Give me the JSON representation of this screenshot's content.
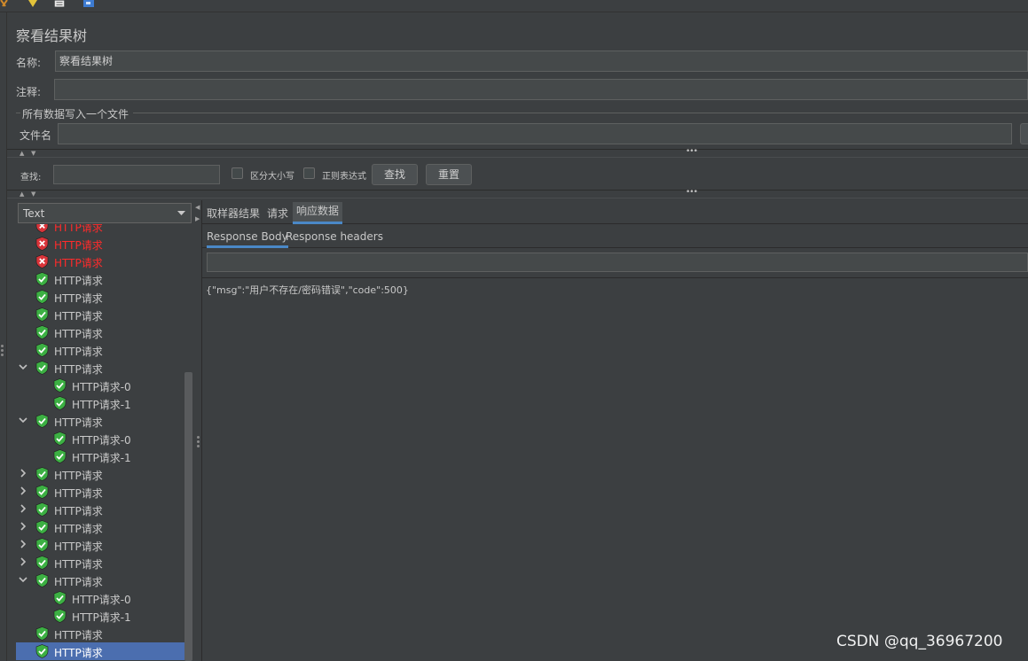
{
  "panel": {
    "title": "察看结果树",
    "name_label": "名称:",
    "name_value": "察看结果树",
    "comment_label": "注释:",
    "comment_value": "",
    "file_group_label": "所有数据写入一个文件",
    "filename_label": "文件名",
    "filename_value": ""
  },
  "search": {
    "label": "查找:",
    "value": "",
    "case_sensitive_label": "区分大小写",
    "regex_label": "正则表达式",
    "find_button": "查找",
    "reset_button": "重置"
  },
  "renderer_select": {
    "selected": "Text"
  },
  "tree": {
    "items": [
      {
        "label": "HTTP请求",
        "status": "error",
        "level": 0,
        "expander": "none"
      },
      {
        "label": "HTTP请求",
        "status": "error",
        "level": 0,
        "expander": "none"
      },
      {
        "label": "HTTP请求",
        "status": "error",
        "level": 0,
        "expander": "none"
      },
      {
        "label": "HTTP请求",
        "status": "ok",
        "level": 0,
        "expander": "none"
      },
      {
        "label": "HTTP请求",
        "status": "ok",
        "level": 0,
        "expander": "none"
      },
      {
        "label": "HTTP请求",
        "status": "ok",
        "level": 0,
        "expander": "none"
      },
      {
        "label": "HTTP请求",
        "status": "ok",
        "level": 0,
        "expander": "none"
      },
      {
        "label": "HTTP请求",
        "status": "ok",
        "level": 0,
        "expander": "none"
      },
      {
        "label": "HTTP请求",
        "status": "ok",
        "level": 0,
        "expander": "expanded"
      },
      {
        "label": "HTTP请求-0",
        "status": "ok",
        "level": 1,
        "expander": "none"
      },
      {
        "label": "HTTP请求-1",
        "status": "ok",
        "level": 1,
        "expander": "none"
      },
      {
        "label": "HTTP请求",
        "status": "ok",
        "level": 0,
        "expander": "expanded"
      },
      {
        "label": "HTTP请求-0",
        "status": "ok",
        "level": 1,
        "expander": "none"
      },
      {
        "label": "HTTP请求-1",
        "status": "ok",
        "level": 1,
        "expander": "none"
      },
      {
        "label": "HTTP请求",
        "status": "ok",
        "level": 0,
        "expander": "collapsed"
      },
      {
        "label": "HTTP请求",
        "status": "ok",
        "level": 0,
        "expander": "collapsed"
      },
      {
        "label": "HTTP请求",
        "status": "ok",
        "level": 0,
        "expander": "collapsed"
      },
      {
        "label": "HTTP请求",
        "status": "ok",
        "level": 0,
        "expander": "collapsed"
      },
      {
        "label": "HTTP请求",
        "status": "ok",
        "level": 0,
        "expander": "collapsed"
      },
      {
        "label": "HTTP请求",
        "status": "ok",
        "level": 0,
        "expander": "collapsed"
      },
      {
        "label": "HTTP请求",
        "status": "ok",
        "level": 0,
        "expander": "expanded"
      },
      {
        "label": "HTTP请求-0",
        "status": "ok",
        "level": 1,
        "expander": "none"
      },
      {
        "label": "HTTP请求-1",
        "status": "ok",
        "level": 1,
        "expander": "none"
      },
      {
        "label": "HTTP请求",
        "status": "ok",
        "level": 0,
        "expander": "none"
      },
      {
        "label": "HTTP请求",
        "status": "ok",
        "level": 0,
        "expander": "none",
        "selected": true
      }
    ]
  },
  "result_tabs": {
    "sampler_result": "取样器结果",
    "request": "请求",
    "response_data": "响应数据",
    "active": "响应数据"
  },
  "response_subtabs": {
    "body": "Response Body",
    "headers": "Response headers",
    "active": "Response Body"
  },
  "response": {
    "search_value": "",
    "body_text": "{\"msg\":\"用户不存在/密码错误\",\"code\":500}"
  },
  "watermark": "CSDN @qq_36967200",
  "colors": {
    "background": "#3c3f41",
    "field": "#45494a",
    "error_text": "#ff2b2b",
    "ok_icon": "#3cb043",
    "error_icon": "#d9343a",
    "selection": "#4b6eaf",
    "tab_underline": "#4a88c7"
  }
}
